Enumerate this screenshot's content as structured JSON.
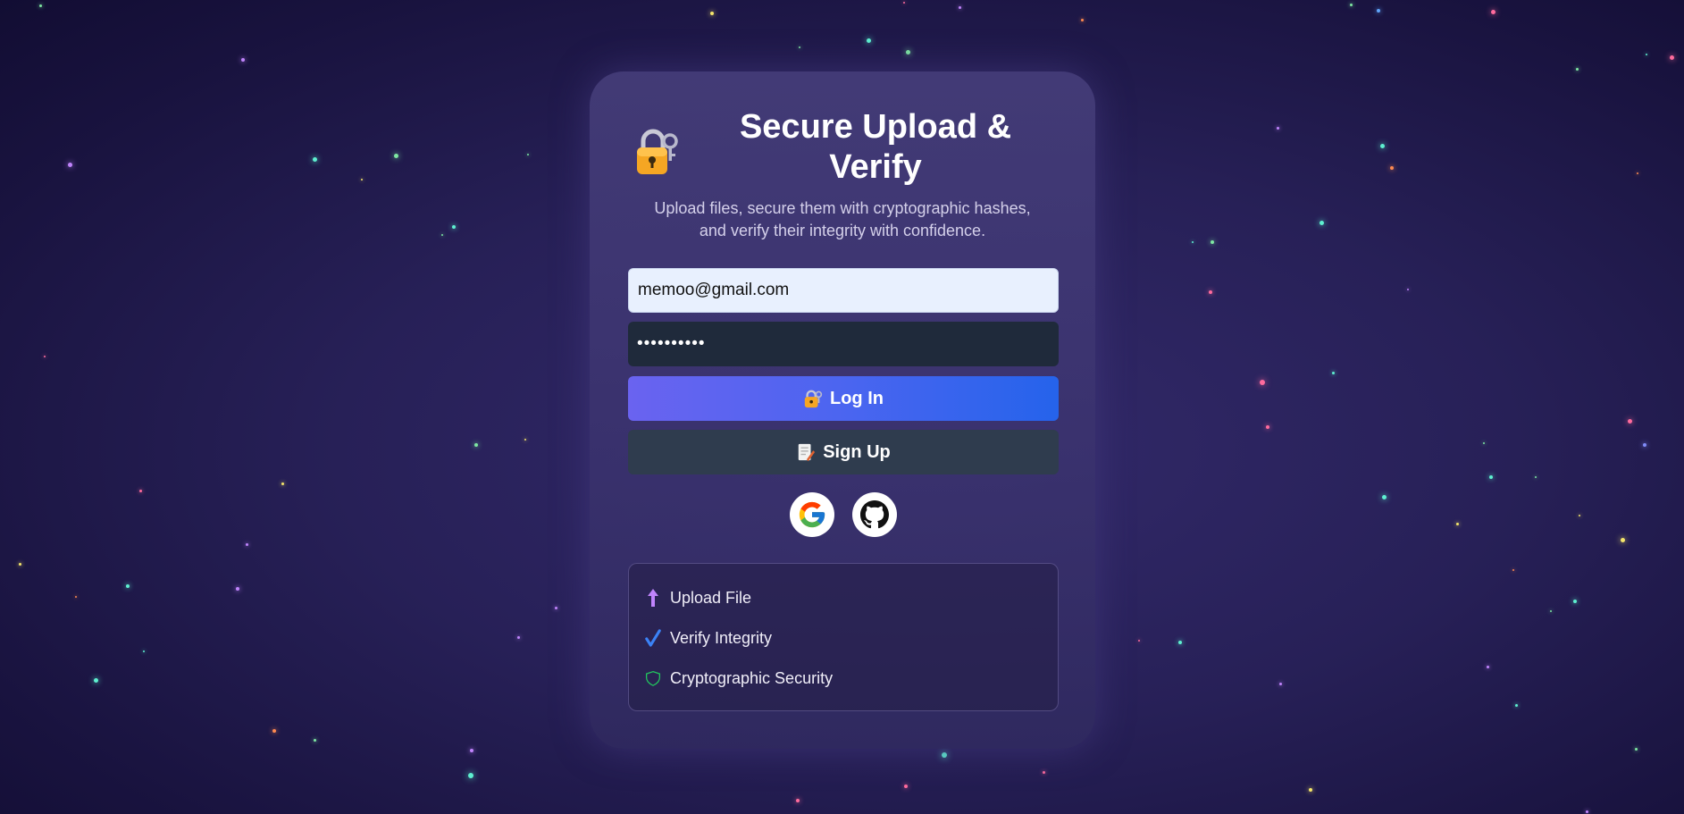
{
  "header": {
    "icon": "lock-with-key-icon",
    "title": "Secure Upload & Verify",
    "subtitle_line1": "Upload files, secure them with cryptographic hashes,",
    "subtitle_line2": "and verify their integrity with confidence."
  },
  "form": {
    "email_value": "memoo@gmail.com",
    "password_value": "••••••••••"
  },
  "buttons": {
    "login_label": "Log In",
    "login_icon": "lock-with-key-icon",
    "signup_label": "Sign Up",
    "signup_icon": "document-with-pen-icon"
  },
  "social": [
    {
      "name": "google",
      "icon": "google-icon"
    },
    {
      "name": "github",
      "icon": "github-icon"
    }
  ],
  "features": [
    {
      "label": "Upload File",
      "icon": "upload-arrow-icon",
      "color": "#c084fc"
    },
    {
      "label": "Verify Integrity",
      "icon": "checkmark-icon",
      "color": "#3b82f6"
    },
    {
      "label": "Cryptographic Security",
      "icon": "shield-icon",
      "color": "#22c55e"
    }
  ],
  "colors": {
    "accent_start": "#6a63f0",
    "accent_end": "#2563eb",
    "signup_bg": "#2f3c4e",
    "password_bg": "#1f2a3b"
  }
}
